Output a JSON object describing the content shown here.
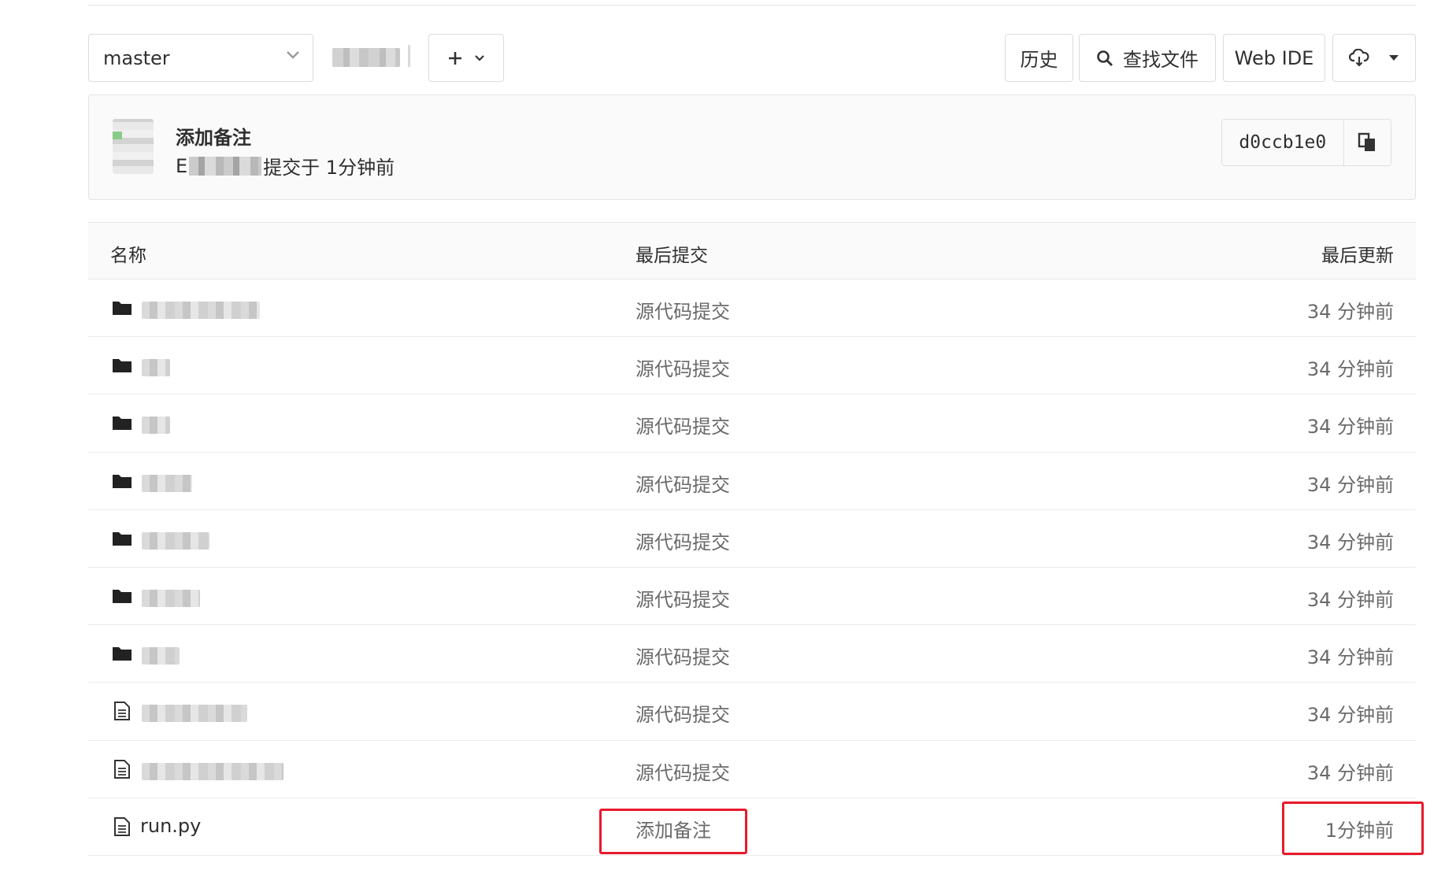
{
  "toolbar": {
    "branch": "master",
    "history_label": "历史",
    "find_file_label": "查找文件",
    "web_ide_label": "Web IDE"
  },
  "commit": {
    "title": "添加备注",
    "author_initial": "E",
    "meta_suffix": "提交于 1分钟前",
    "sha": "d0ccb1e0"
  },
  "table": {
    "headers": {
      "name": "名称",
      "last_commit": "最后提交",
      "last_updated": "最后更新"
    },
    "rows": [
      {
        "type": "folder",
        "name": "",
        "commit": "源代码提交",
        "updated": "34 分钟前"
      },
      {
        "type": "folder",
        "name": "",
        "commit": "源代码提交",
        "updated": "34 分钟前"
      },
      {
        "type": "folder",
        "name": "",
        "commit": "源代码提交",
        "updated": "34 分钟前"
      },
      {
        "type": "folder",
        "name": "",
        "commit": "源代码提交",
        "updated": "34 分钟前"
      },
      {
        "type": "folder",
        "name": "",
        "commit": "源代码提交",
        "updated": "34 分钟前"
      },
      {
        "type": "folder",
        "name": "",
        "commit": "源代码提交",
        "updated": "34 分钟前"
      },
      {
        "type": "folder",
        "name": "",
        "commit": "源代码提交",
        "updated": "34 分钟前"
      },
      {
        "type": "file",
        "name": "",
        "commit": "源代码提交",
        "updated": "34 分钟前"
      },
      {
        "type": "file",
        "name": "",
        "commit": "源代码提交",
        "updated": "34 分钟前"
      },
      {
        "type": "file",
        "name": "run.py",
        "commit": "添加备注",
        "updated": "1分钟前"
      }
    ]
  },
  "colors": {
    "highlight": "#e8192c",
    "panel_bg": "#fafafa",
    "border": "#e3e3e3"
  },
  "icons": [
    "chevron-down-icon",
    "plus-icon",
    "search-icon",
    "cloud-download-icon",
    "caret-down-icon",
    "copy-icon",
    "folder-icon",
    "file-icon"
  ]
}
